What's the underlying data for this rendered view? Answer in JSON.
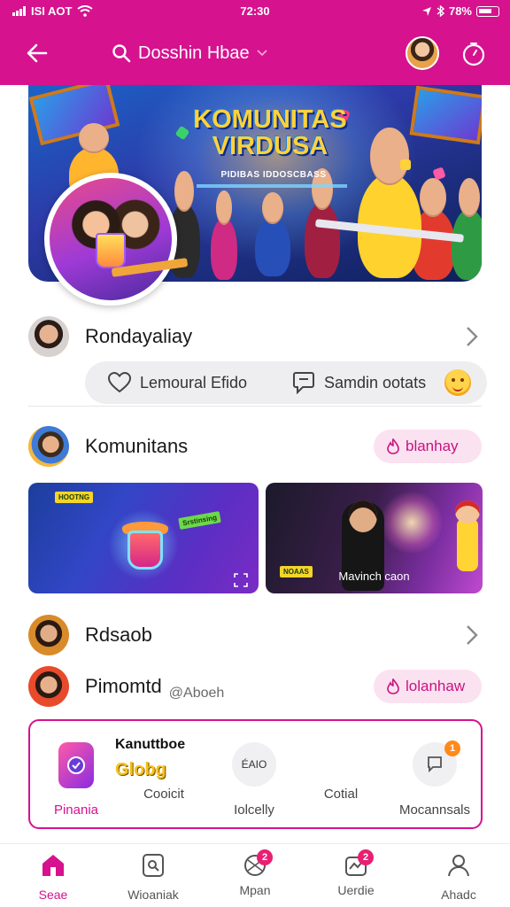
{
  "status": {
    "carrier": "ISI AOT",
    "time": "72:30",
    "battery": "78%"
  },
  "header": {
    "search_text": "Dosshin Hbae"
  },
  "hero": {
    "title": "KOMUNITAS VIRDUSA",
    "subtitle": "PIDIBAS IDDOSCBASS"
  },
  "row1": {
    "title": "Rondayaliay"
  },
  "actions": {
    "left_label": "Lemoural Efido",
    "right_label": "Samdin ootats"
  },
  "section": {
    "title": "Komunitans",
    "pill_label": "blanhay"
  },
  "cards": {
    "tag1": "HOOTNG",
    "tag2": "Srstinsing",
    "tag3": "NOAAS",
    "caption": "Mavinch caon"
  },
  "row3": {
    "title": "Rdsaob"
  },
  "row4": {
    "title": "Pimomtd",
    "handle": "@Aboeh",
    "pill_label": "lolanhaw"
  },
  "features": {
    "heading": "Kanuttboe",
    "logo": "Globg",
    "items": [
      {
        "label": "Pinania"
      },
      {
        "label": "Cooicit"
      },
      {
        "label": "Iolcelly",
        "icon_text": "ÉAIO"
      },
      {
        "label": "Cotial"
      },
      {
        "label": "Mocannsals",
        "badge": "1"
      }
    ]
  },
  "bottom_nav": [
    {
      "label": "Seae",
      "active": true
    },
    {
      "label": "Wioaniak"
    },
    {
      "label": "Mpan",
      "badge": "2"
    },
    {
      "label": "Uerdie",
      "badge": "2"
    },
    {
      "label": "Ahadc"
    }
  ],
  "colors": {
    "accent": "#d6128f",
    "pill_bg": "#fbe2f1"
  }
}
